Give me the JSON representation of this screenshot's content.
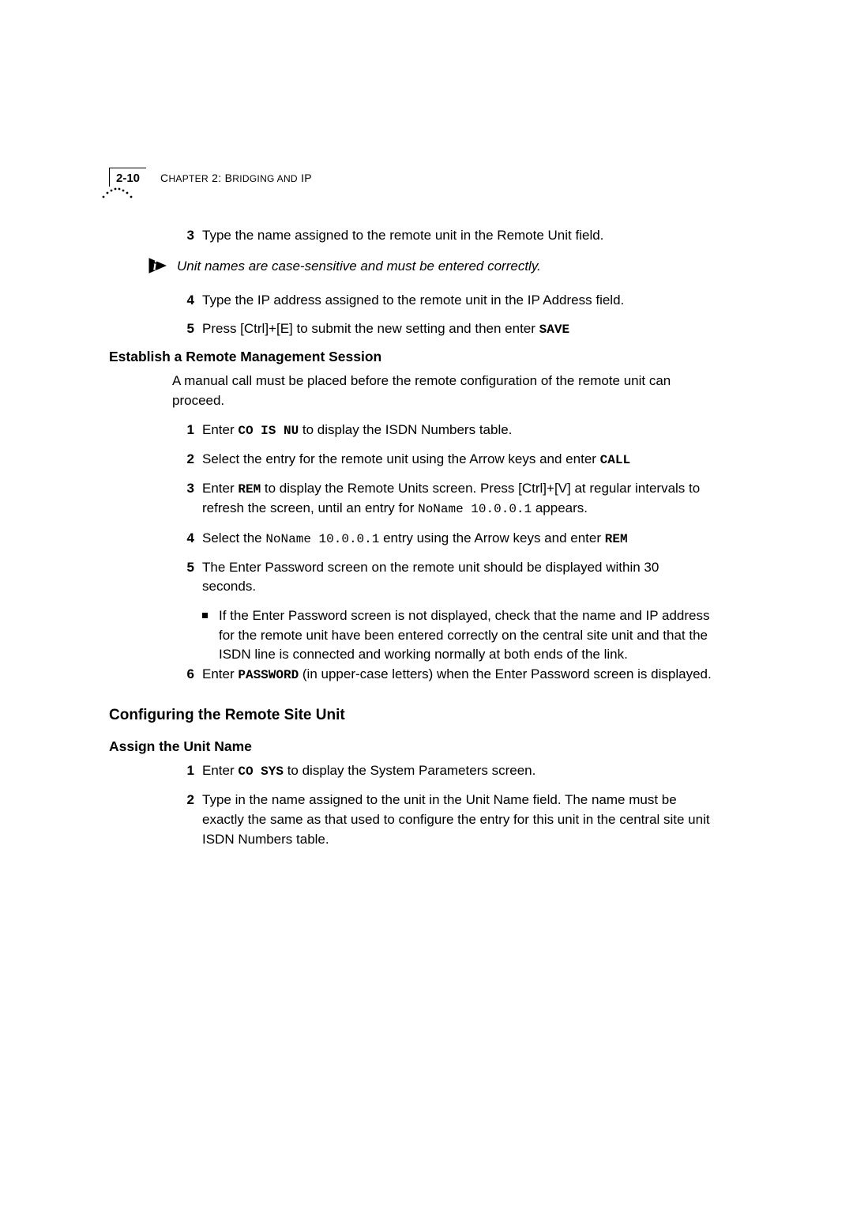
{
  "header": {
    "page_number": "2-10",
    "chapter_label": "Chapter 2: Bridging and IP"
  },
  "blocks": [
    {
      "type": "step",
      "num": "3",
      "html": "Type the name assigned to the remote unit in the Remote Unit field."
    },
    {
      "type": "note",
      "html": "Unit names are case-sensitive and must be entered correctly."
    },
    {
      "type": "step",
      "num": "4",
      "html": "Type the IP address assigned to the remote unit in the IP Address field."
    },
    {
      "type": "step",
      "num": "5",
      "html": "Press [Ctrl]+[E] to submit the new setting and then enter <span class='cmd'>SAVE</span>"
    },
    {
      "type": "h2",
      "html": "Establish a Remote Management Session"
    },
    {
      "type": "para",
      "html": "A manual call must be placed before the remote configuration of the remote unit can proceed."
    },
    {
      "type": "step",
      "num": "1",
      "html": "Enter <span class='cmd'>CO IS NU</span> to display the ISDN Numbers table."
    },
    {
      "type": "step",
      "num": "2",
      "html": "Select the entry for the remote unit using the Arrow keys and enter <span class='cmd'>CALL</span>"
    },
    {
      "type": "step",
      "num": "3",
      "html": "Enter <span class='cmd'>REM</span> to display the Remote Units screen. Press [Ctrl]+[V] at regular intervals to refresh the screen, until an entry for <span class='mono'>NoName 10.0.0.1</span> appears."
    },
    {
      "type": "step",
      "num": "4",
      "html": "Select the <span class='mono'>NoName 10.0.0.1</span> entry using the Arrow keys and enter <span class='cmd'>REM</span>"
    },
    {
      "type": "step",
      "num": "5",
      "html": "The Enter Password screen on the remote unit should be displayed within 30 seconds."
    },
    {
      "type": "subbullet",
      "html": "If the Enter Password screen is not displayed, check that the name and IP address for the remote unit have been entered correctly on the central site unit and that the ISDN line is connected and working normally at both ends of the link."
    },
    {
      "type": "step",
      "num": "6",
      "html": "Enter <span class='cmd'>PASSWORD</span> (in upper-case letters) when the Enter Password screen is displayed."
    },
    {
      "type": "h1",
      "html": "Configuring the Remote Site Unit"
    },
    {
      "type": "h2",
      "html": "Assign the Unit Name"
    },
    {
      "type": "step",
      "num": "1",
      "html": "Enter <span class='cmd'>CO SYS</span> to display the System Parameters screen."
    },
    {
      "type": "step",
      "num": "2",
      "html": "Type in the name assigned to the unit in the Unit Name field. The name must be exactly the same as that used to configure the entry for this unit in the central site unit ISDN Numbers table."
    }
  ]
}
